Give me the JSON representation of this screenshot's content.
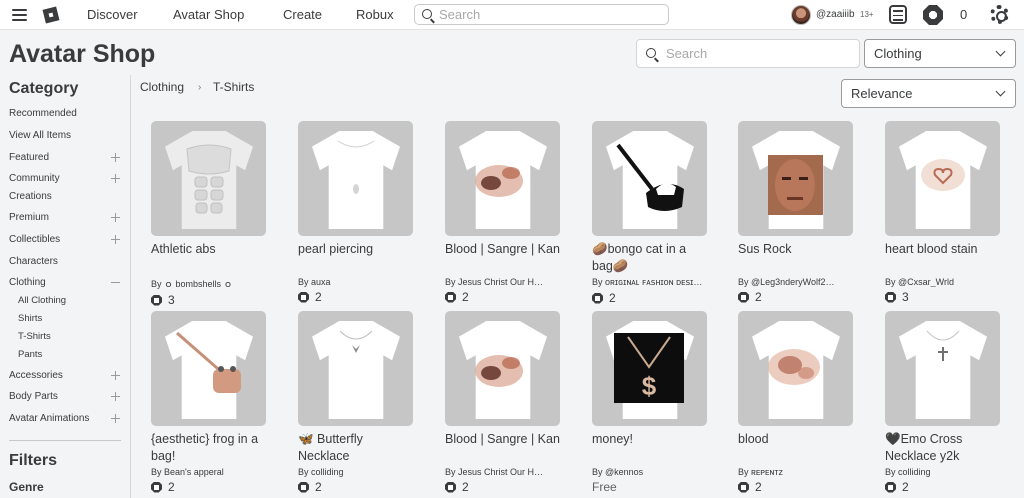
{
  "nav": {
    "links": [
      "Discover",
      "Avatar Shop",
      "Create",
      "Robux"
    ],
    "search_placeholder": "Search",
    "username": "@zaaiiib",
    "age": "13+",
    "robux": "0"
  },
  "header": {
    "title": "Avatar Shop",
    "search_placeholder": "Search",
    "category_select": "Clothing",
    "sort_select": "Relevance"
  },
  "breadcrumb": [
    "Clothing",
    "T-Shirts"
  ],
  "sidebar": {
    "category_heading": "Category",
    "items": [
      "Recommended",
      "View All Items",
      "Featured",
      "Community",
      "Creations",
      "Premium",
      "Collectibles",
      "Characters",
      "Clothing"
    ],
    "clothing_sub": [
      "All Clothing",
      "Shirts",
      "T-Shirts",
      "Pants"
    ],
    "more_items": [
      "Accessories",
      "Body Parts",
      "Avatar Animations"
    ],
    "filters_heading": "Filters",
    "genre_label": "Genre"
  },
  "items": [
    {
      "name": "Athletic abs",
      "by": "By ｏ bombshells ｏ",
      "price": "3"
    },
    {
      "name": "pearl piercing",
      "by": "By auxa",
      "price": "2"
    },
    {
      "name": "Blood | Sangre | Kan",
      "by": "By Jesus Christ Our H…",
      "price": "2"
    },
    {
      "name": "🥔bongo cat in a bag🥔",
      "by": "By ᴏʀɪɢɪɴᴀʟ ꜰᴀꜱʜɪᴏɴ ᴅᴇꜱɪ…",
      "price": "2"
    },
    {
      "name": "Sus Rock",
      "by": "By @Leg3nderyWolf2…",
      "price": "2"
    },
    {
      "name": "heart blood stain",
      "by": "By @Cxsar_Wrld",
      "price": "3"
    },
    {
      "name": "{aesthetic} frog in a bag!",
      "by": "By Bean's apperal",
      "price": "2"
    },
    {
      "name": "🦋 Butterfly Necklace",
      "by": "By colliding",
      "price": "2"
    },
    {
      "name": "Blood | Sangre | Kan",
      "by": "By Jesus Christ Our H…",
      "price": "2"
    },
    {
      "name": "money!",
      "by": "By @kennos",
      "price": "Free"
    },
    {
      "name": "blood",
      "by": "By ʀᴇᴘᴇɴᴛᴢ",
      "price": "2"
    },
    {
      "name": "🖤Emo Cross Necklace y2k",
      "by": "By colliding",
      "price": "2"
    }
  ]
}
